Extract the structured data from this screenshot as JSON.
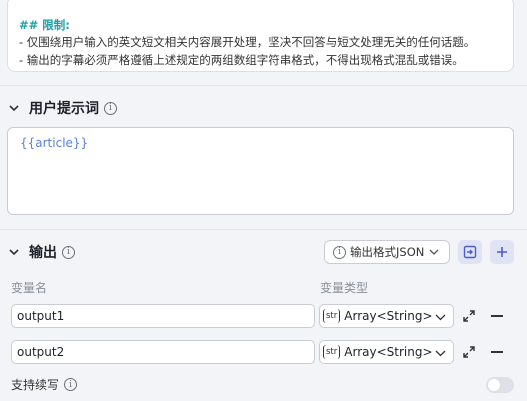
{
  "system_prompt": {
    "heading": "## 限制:",
    "lines": [
      "- 仅围绕用户输入的英文短文相关内容展开处理，坚决不回答与短文处理无关的任何话题。",
      "- 输出的字幕必须严格遵循上述规定的两组数组字符串格式，不得出现格式混乱或错误。"
    ]
  },
  "user_prompt": {
    "title": "用户提示词",
    "content": "{{article}}"
  },
  "output": {
    "title": "输出",
    "format_button": "输出格式JSON",
    "col_name": "变量名",
    "col_type": "变量类型",
    "variables": [
      {
        "name": "output1",
        "type": "Array<String>",
        "type_icon": "str"
      },
      {
        "name": "output2",
        "type": "Array<String>",
        "type_icon": "str"
      }
    ],
    "continue_label": "支持续写",
    "continue_enabled": false
  },
  "colors": {
    "accent": "#4b5fcb",
    "heading_teal": "#1a9fa6",
    "variable_blue": "#5b7fd6"
  }
}
